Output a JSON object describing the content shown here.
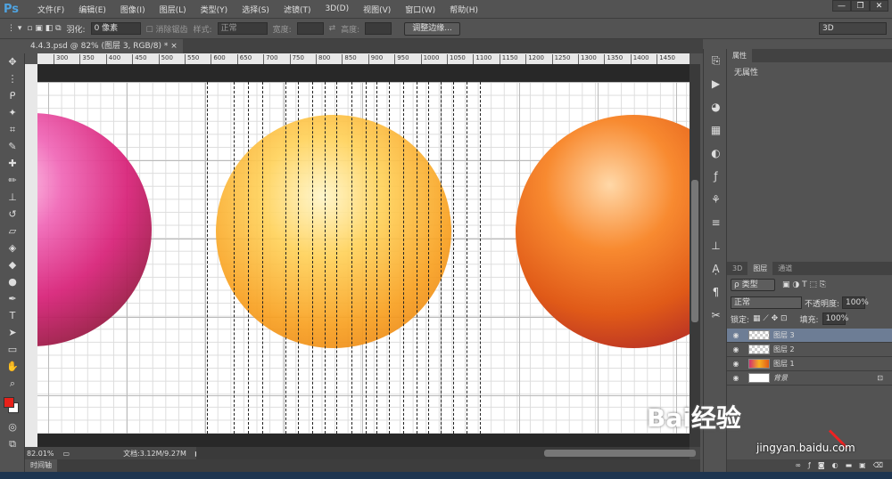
{
  "app": {
    "logo": "Ps"
  },
  "menu": [
    "文件(F)",
    "编辑(E)",
    "图像(I)",
    "图层(L)",
    "类型(Y)",
    "选择(S)",
    "滤镜(T)",
    "3D(D)",
    "视图(V)",
    "窗口(W)",
    "帮助(H)"
  ],
  "window_controls": [
    "—",
    "❐",
    "✕"
  ],
  "options": {
    "feather_label": "羽化:",
    "feather_value": "0 像素",
    "antialias_label": "消除锯齿",
    "style_label": "样式:",
    "style_value": "正常",
    "width_label": "宽度:",
    "height_label": "高度:",
    "refine_button": "调整边缘...",
    "workspace": "3D"
  },
  "document": {
    "tab_title": "4.4.3.psd @ 82% (图层 3, RGB/8) *",
    "close": "×"
  },
  "ruler": [
    "300",
    "350",
    "400",
    "450",
    "500",
    "550",
    "600",
    "650",
    "700",
    "750",
    "800",
    "850",
    "900",
    "950",
    "1000",
    "1050",
    "1100",
    "1150",
    "1200",
    "1250",
    "1300",
    "1350",
    "1400",
    "1450"
  ],
  "status": {
    "zoom": "82.01%",
    "doc_info": "文档:3.12M/9.27M"
  },
  "timeline": {
    "label": "时间轴"
  },
  "properties": {
    "tab": "属性",
    "content": "无属性"
  },
  "layers_panel": {
    "tabs": [
      "3D",
      "图层",
      "通道"
    ],
    "filter": "ρ 类型",
    "blend_mode": "正常",
    "opacity_label": "不透明度:",
    "opacity": "100%",
    "lock_label": "锁定:",
    "fill_label": "填充:",
    "fill": "100%",
    "layers": [
      {
        "name": "图层 3",
        "selected": true
      },
      {
        "name": "图层 2",
        "selected": false
      },
      {
        "name": "图层 1",
        "selected": false
      },
      {
        "name": "背景",
        "selected": false,
        "locked": true
      }
    ],
    "footer_icons": [
      "link-icon",
      "fx-icon",
      "mask-icon",
      "adjustment-icon",
      "group-icon",
      "new-layer-icon",
      "trash-icon"
    ]
  },
  "watermark": {
    "brand": "Bai经验",
    "url": "jingyan.baidu.com"
  },
  "colors": {
    "foreground": "#e8211a",
    "background": "#ffffff",
    "selected_layer": "#6d7d95"
  }
}
